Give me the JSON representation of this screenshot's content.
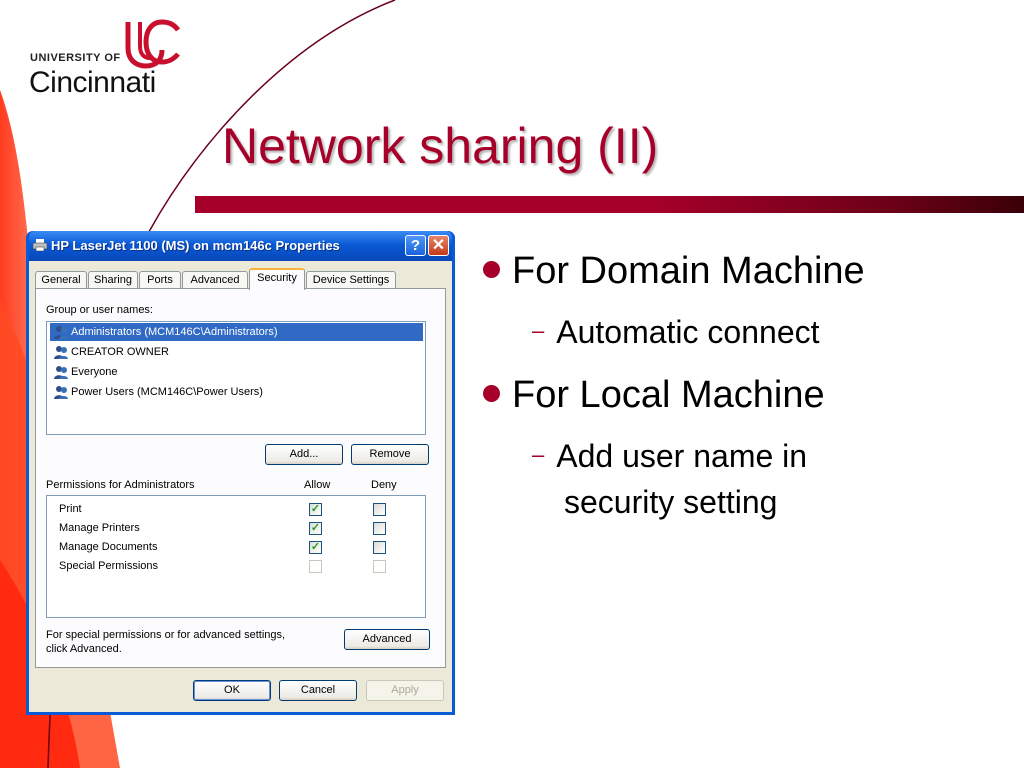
{
  "logo": {
    "line1": "UNIVERSITY OF",
    "line2": "Cincinnati"
  },
  "slide": {
    "title": "Network sharing (II)",
    "accent_color": "#a6002a",
    "bullets": [
      {
        "text": "For Domain Machine",
        "sub": [
          "Automatic connect"
        ]
      },
      {
        "text": "For Local Machine",
        "sub": [
          "Add user name in",
          "security setting"
        ]
      }
    ]
  },
  "dialog": {
    "title": "HP LaserJet 1100 (MS) on mcm146c Properties",
    "help_glyph": "?",
    "close_glyph": "✕",
    "tabs": [
      "General",
      "Sharing",
      "Ports",
      "Advanced",
      "Security",
      "Device Settings"
    ],
    "active_tab": "Security",
    "group_label": "Group or user names:",
    "users": [
      "Administrators (MCM146C\\Administrators)",
      "CREATOR OWNER",
      "Everyone",
      "Power Users (MCM146C\\Power Users)"
    ],
    "selected_user": "Administrators (MCM146C\\Administrators)",
    "add_button": "Add...",
    "remove_button": "Remove",
    "permissions_label": "Permissions for Administrators",
    "allow_header": "Allow",
    "deny_header": "Deny",
    "permissions": [
      {
        "name": "Print",
        "allow": true,
        "deny": false,
        "enabled": true
      },
      {
        "name": "Manage Printers",
        "allow": true,
        "deny": false,
        "enabled": true
      },
      {
        "name": "Manage Documents",
        "allow": true,
        "deny": false,
        "enabled": true
      },
      {
        "name": "Special Permissions",
        "allow": false,
        "deny": false,
        "enabled": false
      }
    ],
    "special_note_line1": "For special permissions or for advanced settings,",
    "special_note_line2": "click Advanced.",
    "advanced_button": "Advanced",
    "ok_button": "OK",
    "cancel_button": "Cancel",
    "apply_button": "Apply"
  }
}
